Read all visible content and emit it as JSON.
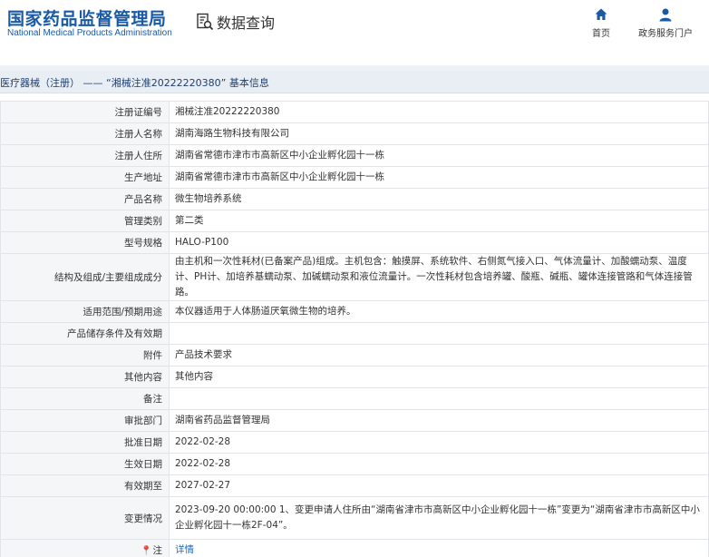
{
  "header": {
    "logo_cn": "国家药品监督管理局",
    "logo_en": "National Medical Products Administration",
    "app_title": "数据查询",
    "nav": [
      {
        "label": "首页",
        "icon": "home-icon"
      },
      {
        "label": "政务服务门户",
        "icon": "user-icon"
      }
    ]
  },
  "breadcrumb": "医疗器械（注册） —— “湘械注准20222220380” 基本信息",
  "rows": [
    {
      "key": "注册证编号",
      "value": "湘械注准20222220380"
    },
    {
      "key": "注册人名称",
      "value": "湖南海路生物科技有限公司"
    },
    {
      "key": "注册人住所",
      "value": "湖南省常德市津市市高新区中小企业孵化园十一栋"
    },
    {
      "key": "生产地址",
      "value": "湖南省常德市津市市高新区中小企业孵化园十一栋"
    },
    {
      "key": "产品名称",
      "value": "微生物培养系统"
    },
    {
      "key": "管理类别",
      "value": "第二类"
    },
    {
      "key": "型号规格",
      "value": "HALO-P100"
    },
    {
      "key": "结构及组成/主要组成成分",
      "value": "由主机和一次性耗材(已备案产品)组成。主机包含：触摸屏、系统软件、右侧氮气接入口、气体流量计、加酸蠕动泵、温度计、PH计、加培养基蠕动泵、加碱蠕动泵和液位流量计。一次性耗材包含培养罐、酸瓶、碱瓶、罐体连接管路和气体连接管路。"
    },
    {
      "key": "适用范围/预期用途",
      "value": "本仪器适用于人体肠道厌氧微生物的培养。"
    },
    {
      "key": "产品储存条件及有效期",
      "value": ""
    },
    {
      "key": "附件",
      "value": "产品技术要求"
    },
    {
      "key": "其他内容",
      "value": "其他内容"
    },
    {
      "key": "备注",
      "value": ""
    },
    {
      "key": "审批部门",
      "value": "湖南省药品监督管理局"
    },
    {
      "key": "批准日期",
      "value": "2022-02-28"
    },
    {
      "key": "生效日期",
      "value": "2022-02-28"
    },
    {
      "key": "有效期至",
      "value": "2027-02-27"
    },
    {
      "key": "变更情况",
      "value": "2023-09-20 00:00:00 1、变更申请人住所由“湖南省津市市高新区中小企业孵化园十一栋”变更为“湖南省津市市高新区中小企业孵化园十一栋2F-04”。"
    },
    {
      "key": "注",
      "value": "详情",
      "key_icon": "pin-icon"
    }
  ],
  "colors": {
    "brand": "#1a5aa5",
    "link": "#1f6bc4",
    "key_bg": "#f5f6f8",
    "border": "#e1e5ea"
  }
}
